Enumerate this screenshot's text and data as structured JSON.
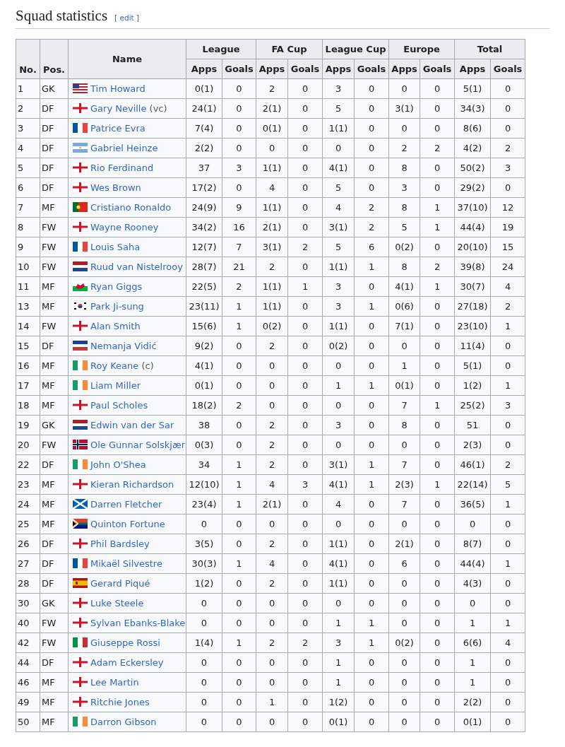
{
  "heading": {
    "title": "Squad statistics",
    "edit": {
      "open": "[",
      "label": "edit",
      "close": "]"
    }
  },
  "table": {
    "columns": [
      "No.",
      "Pos.",
      "Name"
    ],
    "groups": [
      {
        "label": "League",
        "sub": [
          "Apps",
          "Goals"
        ]
      },
      {
        "label": "FA Cup",
        "sub": [
          "Apps",
          "Goals"
        ]
      },
      {
        "label": "League Cup",
        "sub": [
          "Apps",
          "Goals"
        ]
      },
      {
        "label": "Europe",
        "sub": [
          "Apps",
          "Goals"
        ]
      },
      {
        "label": "Total",
        "sub": [
          "Apps",
          "Goals"
        ]
      }
    ],
    "rows": [
      {
        "no": "1",
        "pos": "GK",
        "kind": "usa",
        "name": "Tim Howard",
        "stats": [
          "0(1)",
          "0",
          "2",
          "0",
          "3",
          "0",
          "0",
          "0",
          "5(1)",
          "0"
        ]
      },
      {
        "no": "2",
        "pos": "DF",
        "kind": "eng",
        "name": "Gary Neville",
        "note": "(vc)",
        "stats": [
          "24(1)",
          "0",
          "2(1)",
          "0",
          "5",
          "0",
          "3(1)",
          "0",
          "34(3)",
          "0"
        ]
      },
      {
        "no": "3",
        "pos": "DF",
        "kind": "fra",
        "name": "Patrice Evra",
        "stats": [
          "7(4)",
          "0",
          "0(1)",
          "0",
          "1(1)",
          "0",
          "0",
          "0",
          "8(6)",
          "0"
        ]
      },
      {
        "no": "4",
        "pos": "DF",
        "kind": "arg",
        "name": "Gabriel Heinze",
        "stats": [
          "2(2)",
          "0",
          "0",
          "0",
          "0",
          "0",
          "2",
          "2",
          "4(2)",
          "2"
        ]
      },
      {
        "no": "5",
        "pos": "DF",
        "kind": "eng",
        "name": "Rio Ferdinand",
        "stats": [
          "37",
          "3",
          "1(1)",
          "0",
          "4(1)",
          "0",
          "8",
          "0",
          "50(2)",
          "3"
        ]
      },
      {
        "no": "6",
        "pos": "DF",
        "kind": "eng",
        "name": "Wes Brown",
        "stats": [
          "17(2)",
          "0",
          "4",
          "0",
          "5",
          "0",
          "3",
          "0",
          "29(2)",
          "0"
        ]
      },
      {
        "no": "7",
        "pos": "MF",
        "kind": "por",
        "name": "Cristiano Ronaldo",
        "stats": [
          "24(9)",
          "9",
          "1(1)",
          "0",
          "4",
          "2",
          "8",
          "1",
          "37(10)",
          "12"
        ]
      },
      {
        "no": "8",
        "pos": "FW",
        "kind": "eng",
        "name": "Wayne Rooney",
        "stats": [
          "34(2)",
          "16",
          "2(1)",
          "0",
          "3(1)",
          "2",
          "5",
          "1",
          "44(4)",
          "19"
        ]
      },
      {
        "no": "9",
        "pos": "FW",
        "kind": "fra",
        "name": "Louis Saha",
        "stats": [
          "12(7)",
          "7",
          "3(1)",
          "2",
          "5",
          "6",
          "0(2)",
          "0",
          "20(10)",
          "15"
        ]
      },
      {
        "no": "10",
        "pos": "FW",
        "kind": "ned",
        "name": "Ruud van Nistelrooy",
        "stats": [
          "28(7)",
          "21",
          "2",
          "0",
          "1(1)",
          "1",
          "8",
          "2",
          "39(8)",
          "24"
        ]
      },
      {
        "no": "11",
        "pos": "MF",
        "kind": "wal",
        "name": "Ryan Giggs",
        "stats": [
          "22(5)",
          "2",
          "1(1)",
          "1",
          "3",
          "0",
          "4(1)",
          "1",
          "30(7)",
          "4"
        ]
      },
      {
        "no": "13",
        "pos": "MF",
        "kind": "kor",
        "name": "Park Ji-sung",
        "stats": [
          "23(11)",
          "1",
          "1(1)",
          "0",
          "3",
          "1",
          "0(6)",
          "0",
          "27(18)",
          "2"
        ]
      },
      {
        "no": "14",
        "pos": "FW",
        "kind": "eng",
        "name": "Alan Smith",
        "stats": [
          "15(6)",
          "1",
          "0(2)",
          "0",
          "1(1)",
          "0",
          "7(1)",
          "0",
          "23(10)",
          "1"
        ]
      },
      {
        "no": "15",
        "pos": "DF",
        "kind": "scg",
        "name": "Nemanja Vidić",
        "stats": [
          "9(2)",
          "0",
          "2",
          "0",
          "0(2)",
          "0",
          "0",
          "0",
          "11(4)",
          "0"
        ]
      },
      {
        "no": "16",
        "pos": "MF",
        "kind": "irl",
        "name": "Roy Keane",
        "note": "(c)",
        "stats": [
          "4(1)",
          "0",
          "0",
          "0",
          "0",
          "0",
          "1",
          "0",
          "5(1)",
          "0"
        ]
      },
      {
        "no": "17",
        "pos": "MF",
        "kind": "irl",
        "name": "Liam Miller",
        "stats": [
          "0(1)",
          "0",
          "0",
          "0",
          "1",
          "1",
          "0(1)",
          "0",
          "1(2)",
          "1"
        ]
      },
      {
        "no": "18",
        "pos": "MF",
        "kind": "eng",
        "name": "Paul Scholes",
        "stats": [
          "18(2)",
          "2",
          "0",
          "0",
          "0",
          "0",
          "7",
          "1",
          "25(2)",
          "3"
        ]
      },
      {
        "no": "19",
        "pos": "GK",
        "kind": "ned",
        "name": "Edwin van der Sar",
        "stats": [
          "38",
          "0",
          "2",
          "0",
          "3",
          "0",
          "8",
          "0",
          "51",
          "0"
        ]
      },
      {
        "no": "20",
        "pos": "FW",
        "kind": "nor",
        "name": "Ole Gunnar Solskjær",
        "stats": [
          "0(3)",
          "0",
          "2",
          "0",
          "0",
          "0",
          "0",
          "0",
          "2(3)",
          "0"
        ]
      },
      {
        "no": "22",
        "pos": "DF",
        "kind": "irl",
        "name": "John O'Shea",
        "stats": [
          "34",
          "1",
          "2",
          "0",
          "3(1)",
          "1",
          "7",
          "0",
          "46(1)",
          "2"
        ]
      },
      {
        "no": "23",
        "pos": "MF",
        "kind": "eng",
        "name": "Kieran Richardson",
        "stats": [
          "12(10)",
          "1",
          "4",
          "3",
          "4(1)",
          "1",
          "2(3)",
          "1",
          "22(14)",
          "5"
        ]
      },
      {
        "no": "24",
        "pos": "MF",
        "kind": "sco",
        "name": "Darren Fletcher",
        "stats": [
          "23(4)",
          "1",
          "2(1)",
          "0",
          "4",
          "0",
          "7",
          "0",
          "36(5)",
          "1"
        ]
      },
      {
        "no": "25",
        "pos": "MF",
        "kind": "rsa",
        "name": "Quinton Fortune",
        "stats": [
          "0",
          "0",
          "0",
          "0",
          "0",
          "0",
          "0",
          "0",
          "0",
          "0"
        ]
      },
      {
        "no": "26",
        "pos": "DF",
        "kind": "eng",
        "name": "Phil Bardsley",
        "stats": [
          "3(5)",
          "0",
          "2",
          "0",
          "1(1)",
          "0",
          "2(1)",
          "0",
          "8(7)",
          "0"
        ]
      },
      {
        "no": "27",
        "pos": "DF",
        "kind": "fra",
        "name": "Mikaël Silvestre",
        "stats": [
          "30(3)",
          "1",
          "4",
          "0",
          "4(1)",
          "0",
          "6",
          "0",
          "44(4)",
          "1"
        ]
      },
      {
        "no": "28",
        "pos": "DF",
        "kind": "esp",
        "name": "Gerard Piqué",
        "stats": [
          "1(2)",
          "0",
          "2",
          "0",
          "1(1)",
          "0",
          "0",
          "0",
          "4(3)",
          "0"
        ]
      },
      {
        "no": "30",
        "pos": "GK",
        "kind": "eng",
        "name": "Luke Steele",
        "stats": [
          "0",
          "0",
          "0",
          "0",
          "0",
          "0",
          "0",
          "0",
          "0",
          "0"
        ]
      },
      {
        "no": "40",
        "pos": "FW",
        "kind": "eng",
        "name": "Sylvan Ebanks-Blake",
        "stats": [
          "0",
          "0",
          "0",
          "0",
          "1",
          "1",
          "0",
          "0",
          "1",
          "1"
        ]
      },
      {
        "no": "42",
        "pos": "FW",
        "kind": "ita",
        "name": "Giuseppe Rossi",
        "stats": [
          "1(4)",
          "1",
          "2",
          "2",
          "3",
          "1",
          "0(2)",
          "0",
          "6(6)",
          "4"
        ]
      },
      {
        "no": "44",
        "pos": "DF",
        "kind": "eng",
        "name": "Adam Eckersley",
        "stats": [
          "0",
          "0",
          "0",
          "0",
          "1",
          "0",
          "0",
          "0",
          "1",
          "0"
        ]
      },
      {
        "no": "46",
        "pos": "MF",
        "kind": "eng",
        "name": "Lee Martin",
        "stats": [
          "0",
          "0",
          "0",
          "0",
          "1",
          "0",
          "0",
          "0",
          "1",
          "0"
        ]
      },
      {
        "no": "49",
        "pos": "MF",
        "kind": "eng",
        "name": "Ritchie Jones",
        "stats": [
          "0",
          "0",
          "1",
          "0",
          "1(2)",
          "0",
          "0",
          "0",
          "2(2)",
          "0"
        ]
      },
      {
        "no": "50",
        "pos": "MF",
        "kind": "irl",
        "name": "Darron Gibson",
        "stats": [
          "0",
          "0",
          "0",
          "0",
          "0(1)",
          "0",
          "0",
          "0",
          "0(1)",
          "0"
        ]
      }
    ]
  }
}
